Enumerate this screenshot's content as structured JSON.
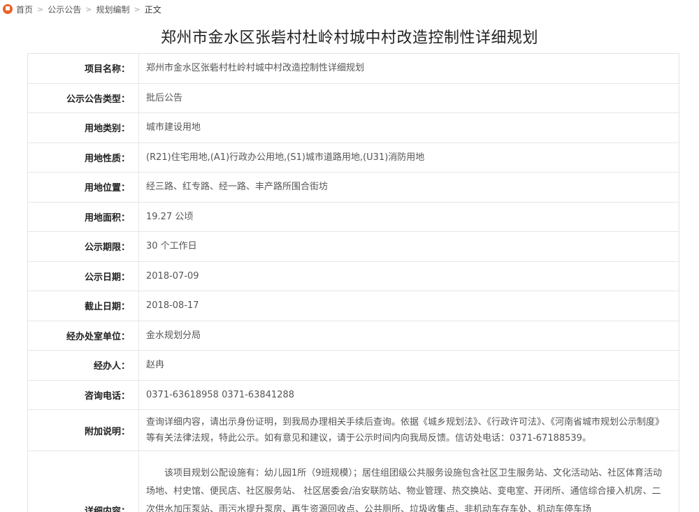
{
  "breadcrumb": {
    "home": "首页",
    "notice": "公示公告",
    "category": "规划编制",
    "current": "正文"
  },
  "title": "郑州市金水区张砦村杜岭村城中村改造控制性详细规划",
  "rows": [
    {
      "label": "项目名称：",
      "value": "郑州市金水区张砦村杜岭村城中村改造控制性详细规划"
    },
    {
      "label": "公示公告类型：",
      "value": "批后公告"
    },
    {
      "label": "用地类别：",
      "value": "城市建设用地"
    },
    {
      "label": "用地性质：",
      "value": "(R21)住宅用地,(A1)行政办公用地,(S1)城市道路用地,(U31)消防用地"
    },
    {
      "label": "用地位置：",
      "value": "经三路、红专路、经一路、丰产路所围合街坊"
    },
    {
      "label": "用地面积：",
      "value": "19.27 公顷"
    },
    {
      "label": "公示期限：",
      "value": "30 个工作日"
    },
    {
      "label": "公示日期：",
      "value": "2018-07-09"
    },
    {
      "label": "截止日期：",
      "value": "2018-08-17"
    },
    {
      "label": "经办处室单位：",
      "value": "金水规划分局"
    },
    {
      "label": "经办人：",
      "value": "赵冉"
    },
    {
      "label": "咨询电话：",
      "value": "0371-63618958 0371-63841288"
    }
  ],
  "note": {
    "label": "附加说明：",
    "value": "查询详细内容，请出示身份证明，到我局办理相关手续后查询。依据《城乡规划法》、《行政许可法》、《河南省城市规划公示制度》等有关法律法规，特此公示。如有意见和建议，请于公示时间内向我局反馈。信访处电话：0371-67188539。"
  },
  "detail": {
    "label": "详细内容：",
    "value": "该项目规划公配设施有：幼儿园1所（9班规模）；居住组团级公共服务设施包含社区卫生服务站、文化活动站、社区体育活动场地、村史馆、便民店、社区服务站、 社区居委会/治安联防站、物业管理、热交换站、变电室、开闭所、通信综合接入机房、二次供水加压泵站、雨污水提升泵房、再生资源回收点、公共厕所、垃圾收集点、非机动车存车处、机动车停车场"
  }
}
